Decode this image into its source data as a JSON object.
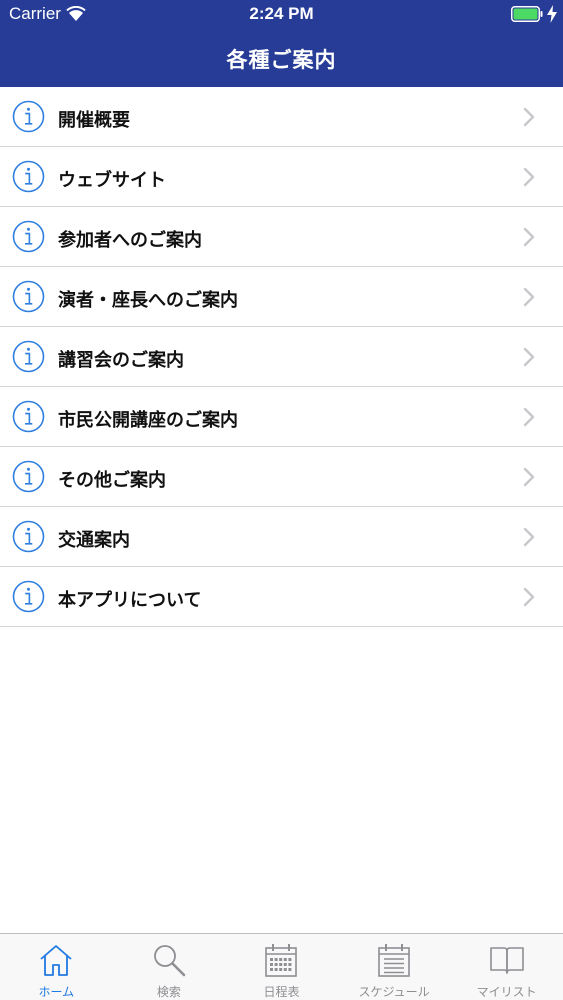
{
  "status_bar": {
    "carrier": "Carrier",
    "time": "2:24 PM"
  },
  "nav": {
    "title": "各種ご案内"
  },
  "colors": {
    "header_bg": "#263c96",
    "accent": "#1f7ae0",
    "inactive": "#8e8e93",
    "battery": "#4cd964"
  },
  "list": {
    "items": [
      {
        "label": "開催概要",
        "icon": "info-icon"
      },
      {
        "label": "ウェブサイト",
        "icon": "info-icon"
      },
      {
        "label": "参加者へのご案内",
        "icon": "info-icon"
      },
      {
        "label": "演者・座長へのご案内",
        "icon": "info-icon"
      },
      {
        "label": "講習会のご案内",
        "icon": "info-icon"
      },
      {
        "label": "市民公開講座のご案内",
        "icon": "info-icon"
      },
      {
        "label": "その他ご案内",
        "icon": "info-icon"
      },
      {
        "label": "交通案内",
        "icon": "info-icon"
      },
      {
        "label": "本アプリについて",
        "icon": "info-icon"
      }
    ]
  },
  "tabs": [
    {
      "label": "ホーム",
      "icon": "home-icon",
      "active": true
    },
    {
      "label": "検索",
      "icon": "search-icon",
      "active": false
    },
    {
      "label": "日程表",
      "icon": "calendar-icon",
      "active": false
    },
    {
      "label": "スケジュール",
      "icon": "schedule-icon",
      "active": false
    },
    {
      "label": "マイリスト",
      "icon": "book-icon",
      "active": false
    }
  ]
}
